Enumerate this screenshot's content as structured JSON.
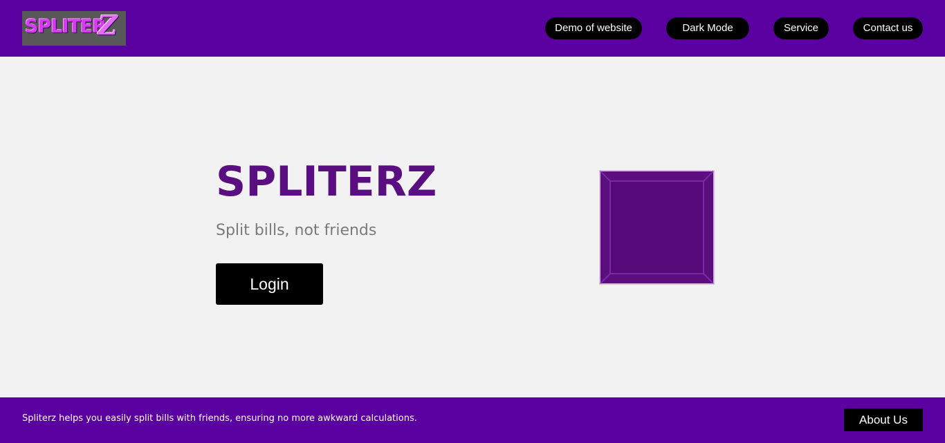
{
  "header": {
    "logo": {
      "text_main": "SPLITER",
      "text_z": "Z"
    },
    "nav": [
      {
        "label": "Demo of website"
      },
      {
        "label": "Dark Mode"
      },
      {
        "label": "Service"
      },
      {
        "label": "Contact us"
      }
    ]
  },
  "hero": {
    "title": "SPLITERZ",
    "subtitle": "Split bills, not friends",
    "login_label": "Login"
  },
  "footer": {
    "text": "Spliterz helps you easily split bills with friends, ensuring no more awkward calculations.",
    "about_label": "About Us"
  },
  "colors": {
    "brand_purple": "#5b00a0",
    "title_purple": "#5a0f80",
    "cube_purple": "#5c0d7e",
    "button_black": "#000000",
    "background": "#f3f2f3"
  }
}
